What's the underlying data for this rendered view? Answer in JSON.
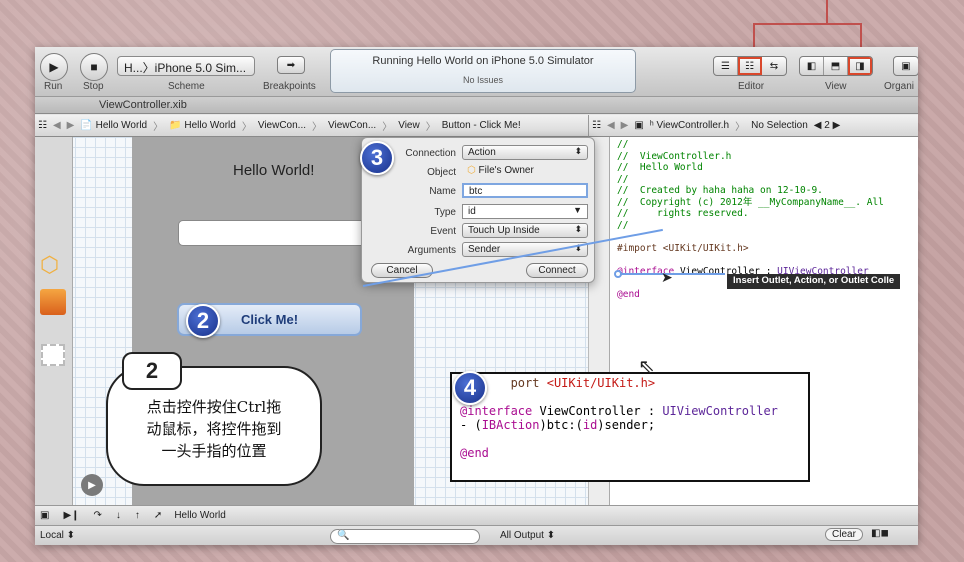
{
  "toolbar": {
    "run_label": "Run",
    "stop_label": "Stop",
    "scheme_value": "H...〉iPhone 5.0 Sim...",
    "scheme_label": "Scheme",
    "breakpoints_label": "Breakpoints",
    "activity_status": "Running Hello World on iPhone 5.0 Simulator",
    "activity_issues": "No Issues",
    "editor_label": "Editor",
    "view_label": "View",
    "organizer_label": "Organi"
  },
  "tab": {
    "title": "ViewController.xib"
  },
  "jumpbar_left": {
    "items": [
      "Hello World",
      "Hello World",
      "ViewCon...",
      "ViewCon...",
      "View",
      "Button - Click Me!"
    ]
  },
  "jumpbar_right": {
    "file": "ViewController.h",
    "selection": "No Selection",
    "counter": "2"
  },
  "canvas": {
    "hello_label": "Hello World!",
    "button_label": "Click Me!"
  },
  "popover": {
    "connection_label": "Connection",
    "connection_value": "Action",
    "object_label": "Object",
    "object_value": "File's Owner",
    "name_label": "Name",
    "name_value": "btc",
    "type_label": "Type",
    "type_value": "id",
    "event_label": "Event",
    "event_value": "Touch Up Inside",
    "arguments_label": "Arguments",
    "arguments_value": "Sender",
    "cancel_label": "Cancel",
    "connect_label": "Connect"
  },
  "code": {
    "l1": "//",
    "l2": "//  ViewController.h",
    "l3": "//  Hello World",
    "l4": "//",
    "l5": "//  Created by haha haha on 12-10-9.",
    "l6": "//  Copyright (c) 2012年 __MyCompanyName__. All",
    "l7": "//     rights reserved.",
    "l8": "//",
    "import_kw": "#import",
    "import_str": "<UIKit/UIKit.h>",
    "interface_kw": "@interface",
    "interface_tx": "ViewController : ",
    "interface_cls": "UIViewController",
    "end_kw": "@end"
  },
  "tooltip": {
    "text": "Insert Outlet, Action, or Outlet Colle"
  },
  "steps": {
    "two": "2",
    "three": "3",
    "four": "4"
  },
  "annotation": {
    "box_number": "2",
    "line1": "点击控件按住Ctrl拖",
    "line2": "动鼠标，将控件拖到",
    "line3": "一头手指的位置"
  },
  "overlay4": {
    "import_partial": "port",
    "import_str": "<UIKit/UIKit.h>",
    "interface_kw": "@interface",
    "interface_tx": "ViewController : ",
    "interface_cls": "UIViewController",
    "action_prefix": "- (",
    "action_kw": "IBAction",
    "action_rest": ")btc:(",
    "action_id": "id",
    "action_end": ")sender;",
    "end_kw": "@end"
  },
  "debug_bar": {
    "target": "Hello World"
  },
  "bottom_bar": {
    "scope": "Local",
    "output": "All Output",
    "clear_label": "Clear"
  }
}
